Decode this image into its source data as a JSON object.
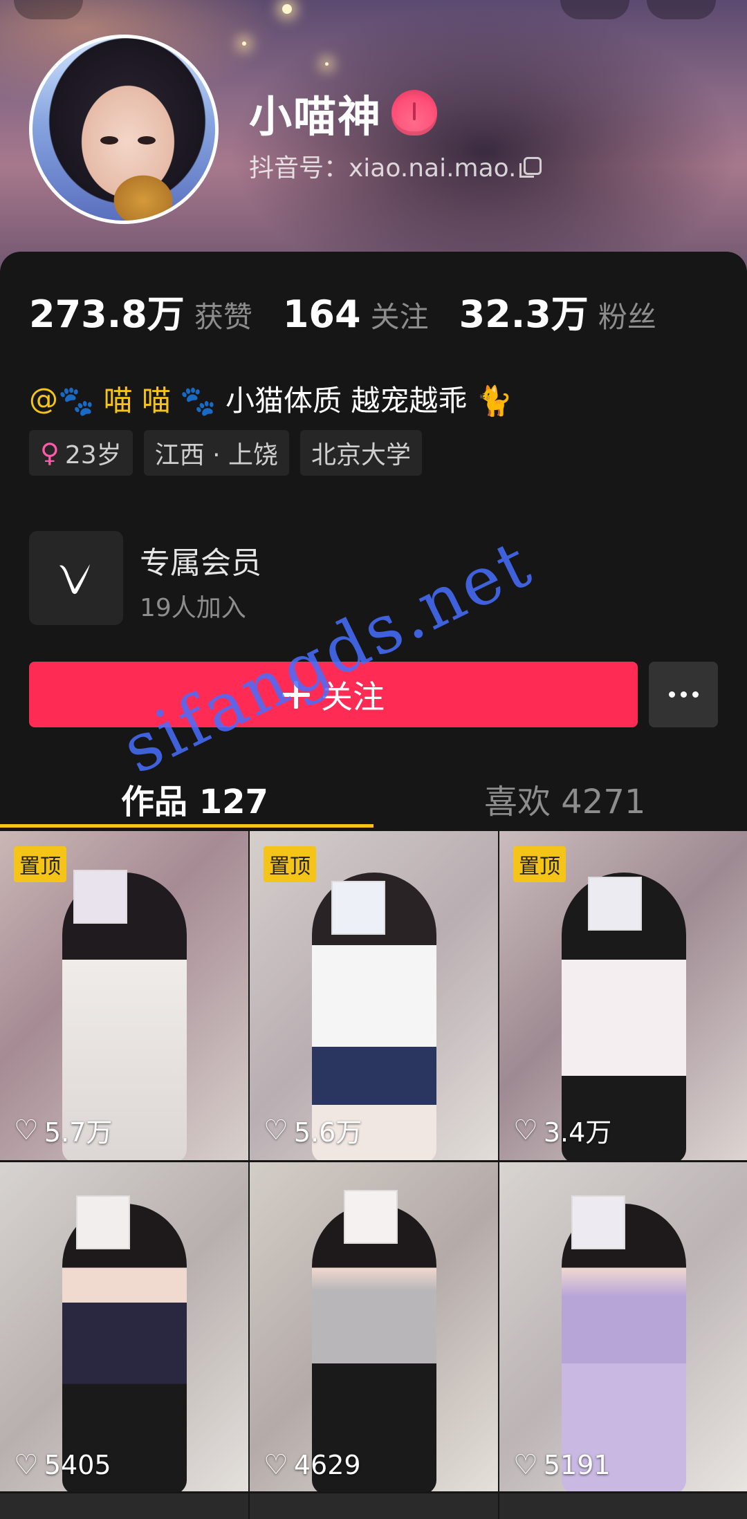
{
  "profile": {
    "nickname": "小喵神",
    "douyin_id": "抖音号：xiao.nai.mao.",
    "accent_color": "#fe2c55"
  },
  "stats": [
    {
      "value": "273.8万",
      "label": "获赞"
    },
    {
      "value": "164",
      "label": "关注"
    },
    {
      "value": "32.3万",
      "label": "粉丝"
    }
  ],
  "bio": {
    "at": "@",
    "mention": "🐾 喵 喵 🐾",
    "text": " 小猫体质 越宠越乖 🐈"
  },
  "tags": {
    "age": "23岁",
    "location": "江西 · 上饶",
    "school": "北京大学"
  },
  "member": {
    "title": "专属会员",
    "subtitle": "19人加入"
  },
  "actions": {
    "follow_label": "关注"
  },
  "tabs": {
    "works": "作品 127",
    "likes": "喜欢 4271"
  },
  "videos": [
    {
      "pinned": "置顶",
      "likes": "5.7万"
    },
    {
      "pinned": "置顶",
      "likes": "5.6万"
    },
    {
      "pinned": "置顶",
      "likes": "3.4万"
    },
    {
      "pinned": "",
      "likes": "5405"
    },
    {
      "pinned": "",
      "likes": "4629"
    },
    {
      "pinned": "",
      "likes": "5191"
    }
  ],
  "watermark": "sifangds.net"
}
